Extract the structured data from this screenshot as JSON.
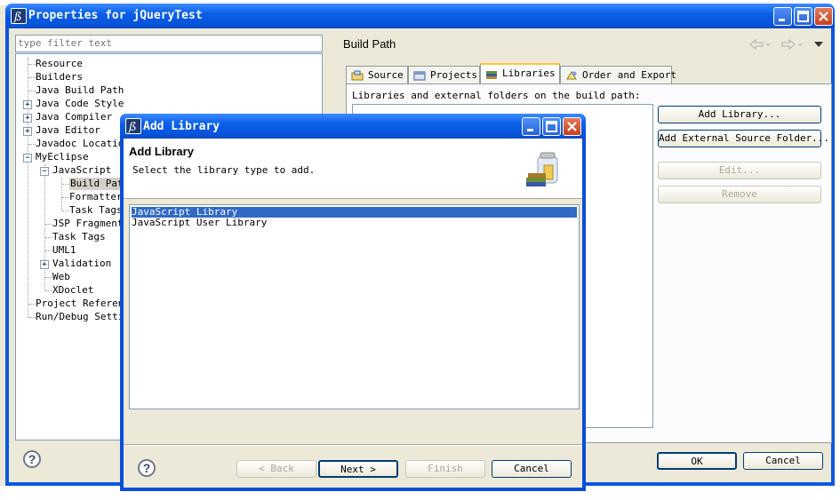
{
  "main_window": {
    "title": "Properties for jQueryTest",
    "filter_placeholder": "type filter text",
    "tree": [
      {
        "label": "Resource"
      },
      {
        "label": "Builders"
      },
      {
        "label": "Java Build Path"
      },
      {
        "label": "Java Code Style"
      },
      {
        "label": "Java Compiler"
      },
      {
        "label": "Java Editor"
      },
      {
        "label": "Javadoc Location"
      },
      {
        "label": "MyEclipse"
      },
      {
        "label": "JavaScript"
      },
      {
        "label": "Build Path"
      },
      {
        "label": "Formatter"
      },
      {
        "label": "Task Tags"
      },
      {
        "label": "JSP Fragments"
      },
      {
        "label": "Task Tags"
      },
      {
        "label": "UML1"
      },
      {
        "label": "Validation"
      },
      {
        "label": "Web"
      },
      {
        "label": "XDoclet"
      },
      {
        "label": "Project References"
      },
      {
        "label": "Run/Debug Settings"
      }
    ],
    "page_title": "Build Path",
    "tabs": [
      {
        "label": "Source"
      },
      {
        "label": "Projects"
      },
      {
        "label": "Libraries"
      },
      {
        "label": "Order and Export"
      }
    ],
    "libraries_label": "Libraries and external folders on the build path:",
    "buttons": {
      "add_library": "Add Library...",
      "add_external_source_folder": "Add External Source Folder...",
      "edit": "Edit...",
      "remove": "Remove",
      "ok": "OK",
      "cancel": "Cancel"
    }
  },
  "dialog": {
    "title": "Add Library",
    "header_title": "Add Library",
    "header_subtitle": "Select the library type to add.",
    "items": [
      {
        "label": "JavaScript Library",
        "selected": true
      },
      {
        "label": "JavaScript User Library",
        "selected": false
      }
    ],
    "buttons": {
      "back": "< Back",
      "next": "Next >",
      "finish": "Finish",
      "cancel": "Cancel"
    }
  },
  "help_symbol": "?",
  "colors": {
    "title_bar": "#0a5fe6",
    "selection": "#316ac5",
    "window_bg": "#ece9d8"
  }
}
